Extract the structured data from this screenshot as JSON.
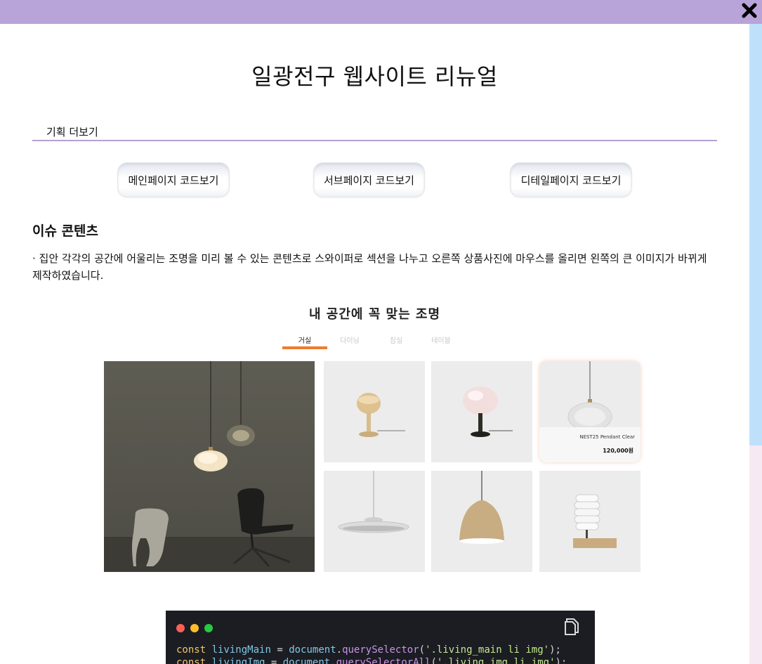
{
  "modal": {
    "title": "일광전구 웹사이트 리뉴얼",
    "plan_more": "기획 더보기",
    "buttons": [
      "메인페이지 코드보기",
      "서브페이지 코드보기",
      "디테일페이지 코드보기"
    ],
    "section_title": "이슈 콘텐츠",
    "section_desc": "· 집안 각각의 공간에 어울리는 조명을 미리 볼 수 있는 콘텐츠로 스와이퍼로 섹션을 나누고 오른쪽 상품사진에 마우스를 올리면 왼쪽의 큰 이미지가 바뀌게 제작하였습니다."
  },
  "embed": {
    "title": "내 공간에 꼭 맞는 조명",
    "tabs": [
      "거실",
      "다이닝",
      "침실",
      "테이블"
    ],
    "active_tab": "거실",
    "hovered_product": {
      "name": "NEST25 Pendant Clear",
      "price": "120,000원"
    },
    "product_icons": [
      "mushroom-table-lamp-icon",
      "pink-globe-table-lamp-icon",
      "glass-pendant-icon",
      "disc-pendant-icon",
      "wood-dome-pendant-icon",
      "stacked-shade-lamp-icon"
    ]
  },
  "code": {
    "lines": [
      {
        "kw": "const",
        "var": "livingMain",
        "obj": "document",
        "fn": "querySelector",
        "str": "'.living_main li img'",
        "end": ");"
      },
      {
        "kw": "const",
        "var": "livingImg",
        "obj": "document",
        "fn": "querySelectorAll",
        "str": "'.living_img li img'",
        "end": ");"
      }
    ]
  },
  "colors": {
    "topbar": "#b8a4d9",
    "underline": "#b8a0cf",
    "tab_accent": "#f07a2e",
    "code_bg": "#1b1d22",
    "dot_red": "#ff5f57",
    "dot_yellow": "#febc2e",
    "dot_green": "#28c840"
  }
}
